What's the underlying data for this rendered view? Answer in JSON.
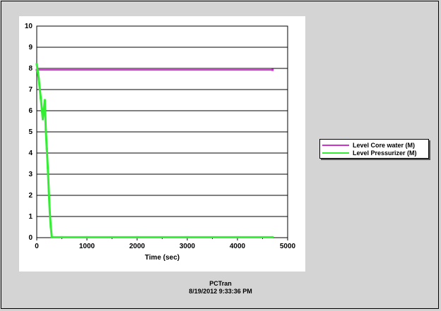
{
  "chart_data": {
    "type": "line",
    "xlabel": "Time (sec)",
    "ylabel": "",
    "xlim": [
      0,
      5000
    ],
    "ylim": [
      0,
      10
    ],
    "xticks": [
      0,
      1000,
      2000,
      3000,
      4000,
      5000
    ],
    "yticks": [
      0,
      1,
      2,
      3,
      4,
      5,
      6,
      7,
      8,
      9,
      10
    ],
    "grid": "horizontal",
    "legend_position": "right",
    "series": [
      {
        "name": "Level Core water (M)",
        "color": "#cc33cc",
        "x": [
          0,
          4700
        ],
        "y": [
          7.93,
          7.93
        ]
      },
      {
        "name": "Level Pressurizer (M)",
        "color": "#33ee33",
        "x": [
          0,
          40,
          80,
          120,
          160,
          180,
          200,
          220,
          240,
          260,
          280,
          300,
          500,
          1000,
          2000,
          3000,
          4000,
          4700
        ],
        "y": [
          8.2,
          7.5,
          6.6,
          5.6,
          6.5,
          5.1,
          4.2,
          3.3,
          2.2,
          1.2,
          0.5,
          0.02,
          0.02,
          0.02,
          0.02,
          0.02,
          0.02,
          0.02
        ]
      }
    ]
  },
  "footer": {
    "line1": "PCTran",
    "line2": "8/19/2012 9:33:36 PM"
  }
}
